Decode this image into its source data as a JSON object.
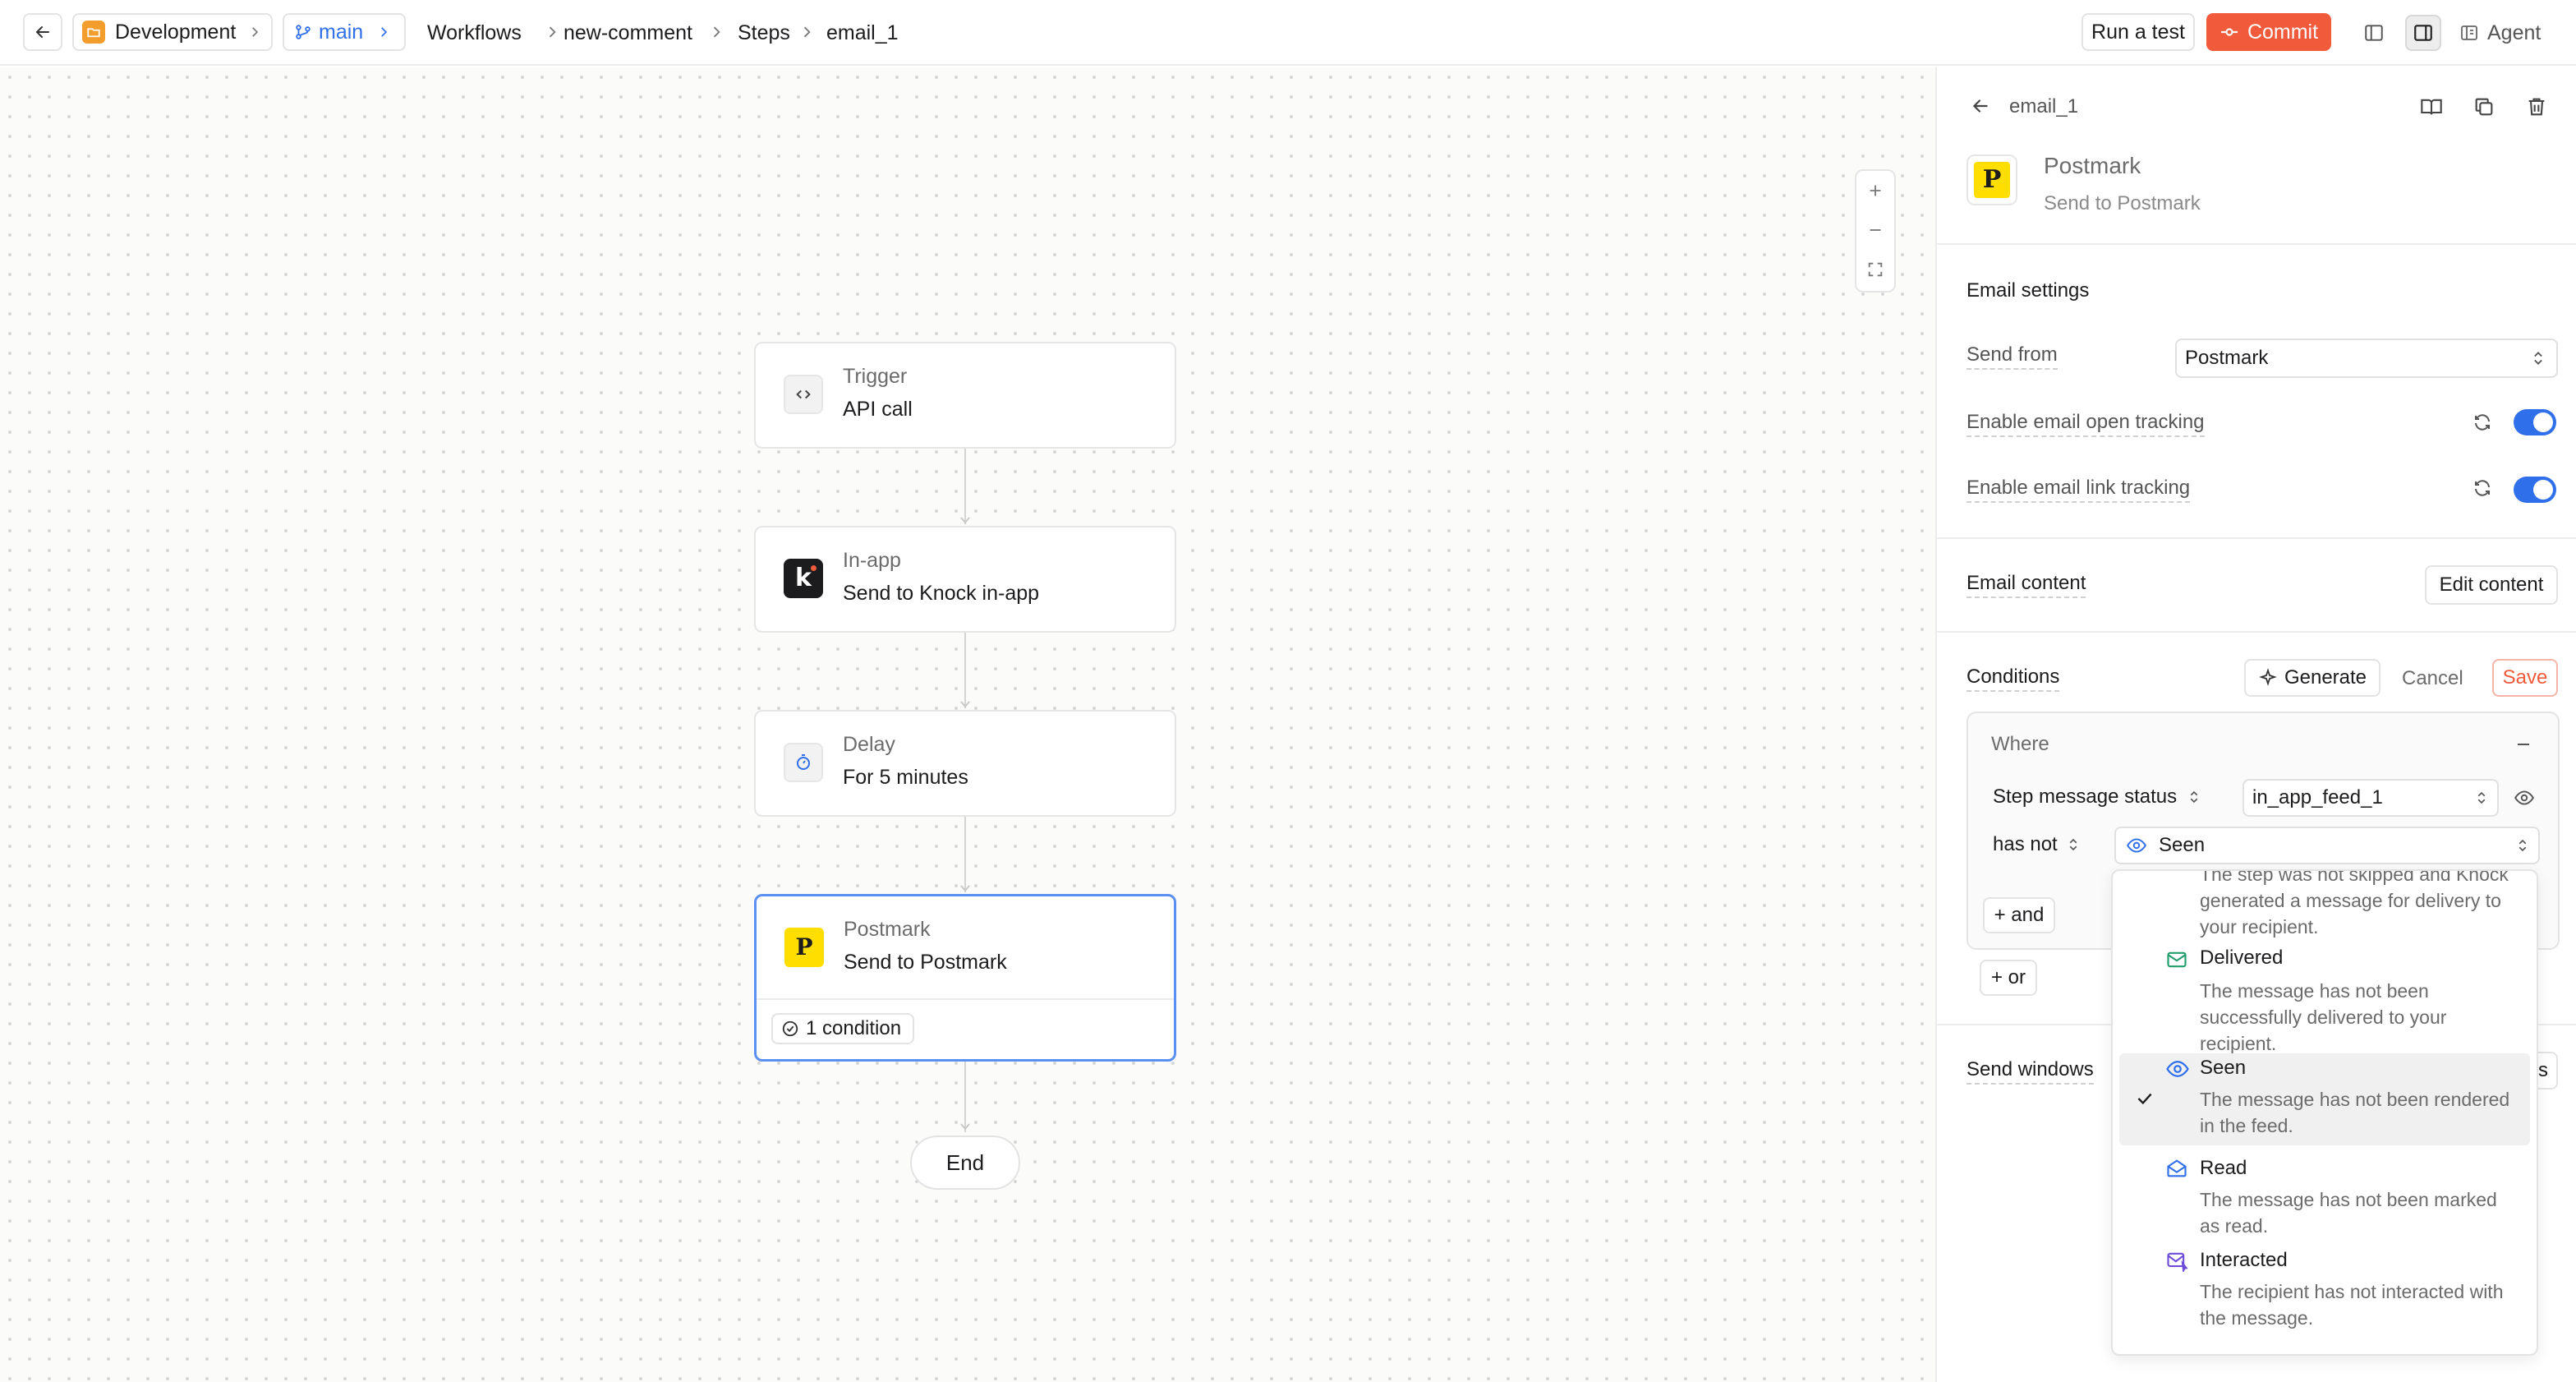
{
  "topbar": {
    "environment": "Development",
    "branch": "main",
    "breadcrumbs": [
      "Workflows",
      "new-comment",
      "Steps",
      "email_1"
    ],
    "run_test": "Run a test",
    "commit": "Commit",
    "agent": "Agent"
  },
  "canvas": {
    "nodes": [
      {
        "title": "Trigger",
        "subtitle": "API call",
        "icon": "code-icon"
      },
      {
        "title": "In-app",
        "subtitle": "Send to Knock in-app",
        "icon": "knock-logo-icon"
      },
      {
        "title": "Delay",
        "subtitle": "For 5 minutes",
        "icon": "timer-icon"
      },
      {
        "title": "Postmark",
        "subtitle": "Send to Postmark",
        "icon": "postmark-logo-icon",
        "badge": "1 condition"
      }
    ],
    "end_label": "End"
  },
  "panel": {
    "step_key": "email_1",
    "channel_name": "Postmark",
    "channel_sub": "Send to Postmark",
    "email_settings": {
      "heading": "Email settings",
      "send_from_label": "Send from",
      "send_from_value": "Postmark",
      "open_tracking_label": "Enable email open tracking",
      "open_tracking_on": true,
      "link_tracking_label": "Enable email link tracking",
      "link_tracking_on": true
    },
    "email_content": {
      "heading": "Email content",
      "edit_button": "Edit content"
    },
    "conditions": {
      "heading": "Conditions",
      "generate": "Generate",
      "cancel": "Cancel",
      "save": "Save",
      "where": "Where",
      "field": "Step message status",
      "step_ref": "in_app_feed_1",
      "operator": "has not",
      "value": "Seen",
      "and_button": "+ and",
      "or_button": "+ or"
    },
    "send_windows": {
      "heading": "Send windows",
      "button_tail": "s"
    }
  },
  "dropdown": {
    "partial_text": "The step was not skipped and Knock generated a message for delivery to your recipient.",
    "options": [
      {
        "label": "Delivered",
        "desc": "The message has not been successfully delivered to your recipient.",
        "icon": "mail-check-icon",
        "selected": false
      },
      {
        "label": "Seen",
        "desc": "The message has not been rendered in the feed.",
        "icon": "eye-icon",
        "selected": true
      },
      {
        "label": "Read",
        "desc": "The message has not been marked as read.",
        "icon": "mail-open-icon",
        "selected": false
      },
      {
        "label": "Interacted",
        "desc": "The recipient has not interacted with the message.",
        "icon": "mail-interact-icon",
        "selected": false
      }
    ]
  },
  "colors": {
    "accent_blue": "#2f6fea",
    "commit_orange": "#f25a3c",
    "postmark_yellow": "#ffde00",
    "delivered_green": "#1f9d6b",
    "interacted_purple": "#6b4bd8"
  }
}
